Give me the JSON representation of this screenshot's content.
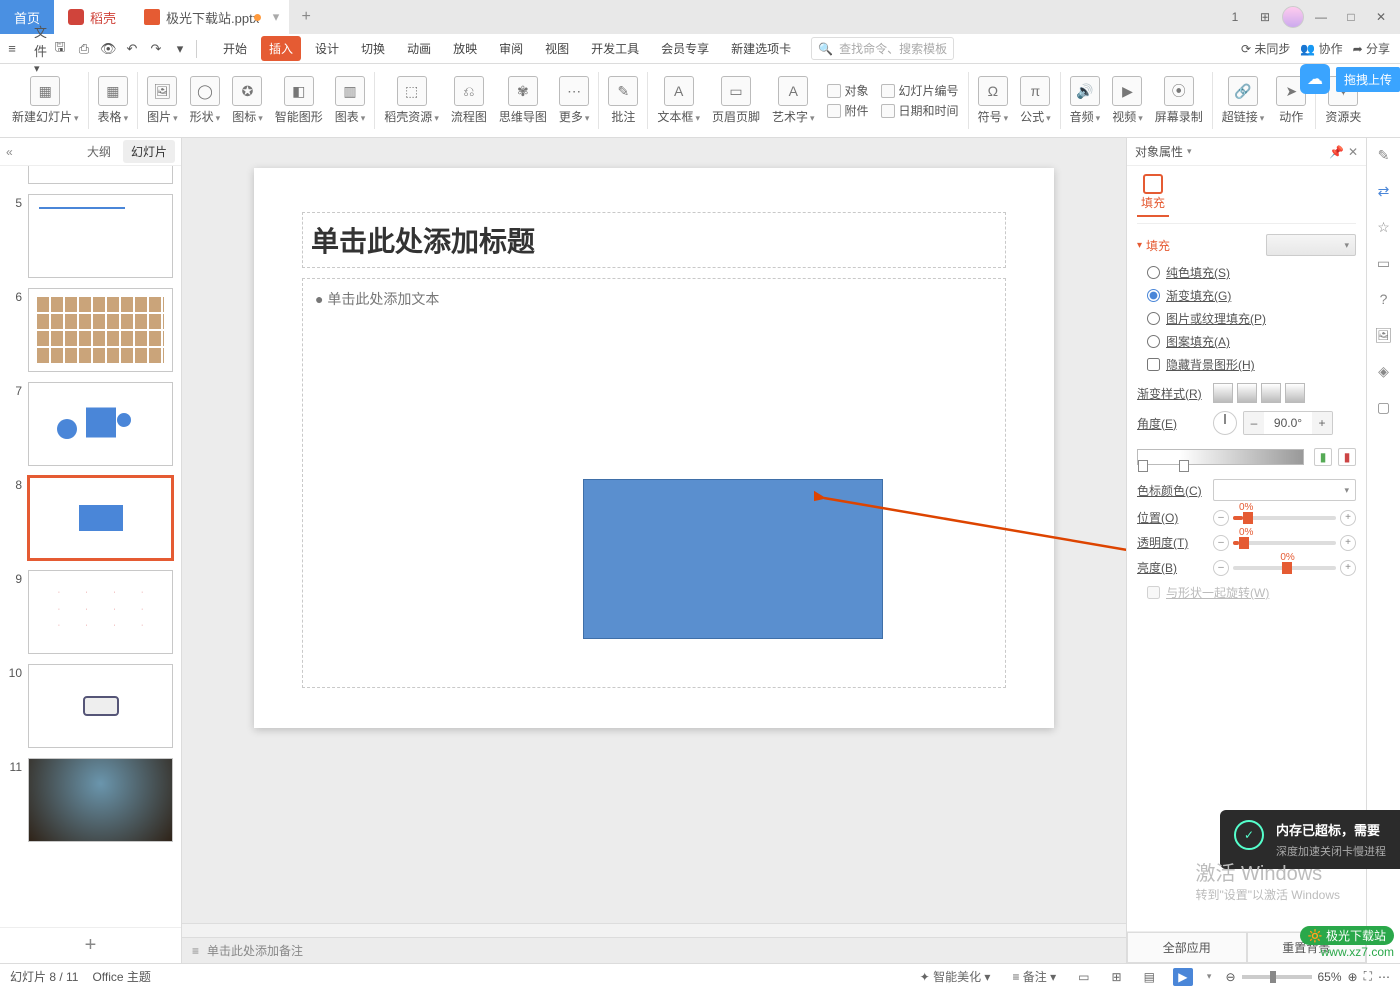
{
  "titlebar": {
    "home": "首页",
    "daoke": "稻壳",
    "doc": "极光下载站.pptx",
    "addTip": "+"
  },
  "wincontrols": {
    "grid": "▦",
    "apps": "⊞",
    "min": "—",
    "max": "□",
    "close": "✕",
    "one": "1"
  },
  "qa": {
    "file": "文件",
    "menu": "≡",
    "save": "🖫",
    "print": "⎙",
    "preview": "👁",
    "undo": "↶",
    "redo": "↷",
    "down": "▾"
  },
  "tabs": [
    "开始",
    "插入",
    "设计",
    "切换",
    "动画",
    "放映",
    "审阅",
    "视图",
    "开发工具",
    "会员专享",
    "新建选项卡"
  ],
  "tabsActive": 1,
  "search": {
    "icon": "🔍",
    "placeholder": "查找命令、搜索模板"
  },
  "rutil": {
    "sync": "⟳ 未同步",
    "coop": "👥 协作",
    "share": "➦ 分享",
    "more": "⋯"
  },
  "cloud": {
    "drag": "拖拽上传"
  },
  "ribbon": {
    "newSlide": "新建幻灯片",
    "table": "表格",
    "picture": "图片",
    "shape": "形状",
    "icon": "图标",
    "smart": "智能图形",
    "chart": "图表",
    "dkres": "稻壳资源",
    "flow": "流程图",
    "mind": "思维导图",
    "more": "更多",
    "comment": "批注",
    "textbox": "文本框",
    "hdrftr": "页眉页脚",
    "wordart": "艺术字",
    "object": "对象",
    "attach": "附件",
    "slidenum": "幻灯片编号",
    "datetime": "日期和时间",
    "symbol": "符号",
    "formula": "公式",
    "audio": "音频",
    "video": "视频",
    "record": "屏幕录制",
    "hyperlink": "超链接",
    "action": "动作",
    "resource": "资源夹"
  },
  "outline": {
    "back": "«",
    "tabOutline": "大纲",
    "tabSlides": "幻灯片",
    "add": "+"
  },
  "slides": [
    {
      "n": 5
    },
    {
      "n": 6
    },
    {
      "n": 7
    },
    {
      "n": 8,
      "sel": true
    },
    {
      "n": 9
    },
    {
      "n": 10
    },
    {
      "n": 11
    }
  ],
  "slide": {
    "title": "单击此处添加标题",
    "body": "● 单击此处添加文本"
  },
  "notes": {
    "icon": "≡",
    "placeholder": "单击此处添加备注"
  },
  "prop": {
    "header": "对象属性",
    "pin": "📌",
    "close": "✕",
    "tabFill": "填充",
    "secFill": "填充",
    "solid": "纯色填充(S)",
    "gradient": "渐变填充(G)",
    "picture": "图片或纹理填充(P)",
    "pattern": "图案填充(A)",
    "hidebg": "隐藏背景图形(H)",
    "gradStyle": "渐变样式(R)",
    "angle": "角度(E)",
    "angleVal": "90.0°",
    "stopColor": "色标颜色(C)",
    "position": "位置(O)",
    "opacity": "透明度(T)",
    "bright": "亮度(B)",
    "pct0": "0%",
    "rotate": "与形状一起旋转(W)",
    "allApps": "全部应用",
    "resetBg": "重置背景"
  },
  "vtb": [
    "✎",
    "⇄",
    "☆",
    "▭",
    "?",
    "🖼",
    "◈",
    "▢"
  ],
  "status": {
    "slideidx": "幻灯片 8 / 11",
    "theme": "Office 主题",
    "beautify": "智能美化",
    "noteBtn": "备注",
    "v1": "▭",
    "v2": "⊞",
    "v3": "▤",
    "play": "▶",
    "zmOut": "⊖",
    "zoom": "65%",
    "zmIn": "⊕",
    "fit": "⛶",
    "more": "⋯"
  },
  "toast": {
    "title": "内存已超标，需要",
    "sub": "深度加速关闭卡慢进程"
  },
  "activate": {
    "t": "激活 Windows",
    "s": "转到\"设置\"以激活 Windows"
  },
  "logo": {
    "brand": "极光下载站",
    "url": "www.xz7.com"
  }
}
